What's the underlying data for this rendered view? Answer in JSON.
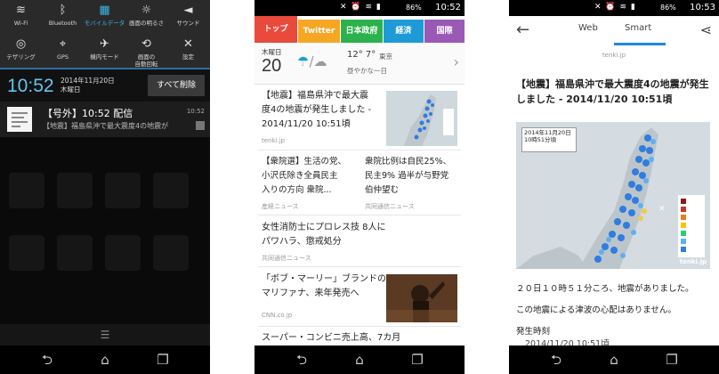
{
  "phone1": {
    "quick_settings": [
      {
        "label": "Wi-Fi",
        "icon": "wifi-icon",
        "glyph": "≋",
        "on": false
      },
      {
        "label": "Bluetooth",
        "icon": "bluetooth-icon",
        "glyph": "ᛒ",
        "on": false
      },
      {
        "label": "モバイルデータ",
        "icon": "mobile-data-icon",
        "glyph": "▦",
        "on": true
      },
      {
        "label": "画面の明るさ",
        "icon": "brightness-icon",
        "glyph": "☼",
        "on": false
      },
      {
        "label": "サウンド",
        "icon": "sound-icon",
        "glyph": "◄",
        "on": false
      },
      {
        "label": "テザリング",
        "icon": "tethering-icon",
        "glyph": "◎",
        "on": false
      },
      {
        "label": "GPS",
        "icon": "gps-icon",
        "glyph": "⌖",
        "on": false
      },
      {
        "label": "機内モード",
        "icon": "airplane-icon",
        "glyph": "✈",
        "on": false
      },
      {
        "label": "画面の\n自動回転",
        "icon": "auto-rotate-icon",
        "glyph": "⟲",
        "on": false
      },
      {
        "label": "設定",
        "icon": "settings-icon",
        "glyph": "✕",
        "on": false
      }
    ],
    "clock": "10:52",
    "date": "2014年11月20日",
    "weekday": "木曜日",
    "clear_all": "すべて削除",
    "notification": {
      "title": "【号外】10:52 配信",
      "time": "10:52",
      "text": "【地震】福島県沖で最大震度4の地震が"
    }
  },
  "phone2": {
    "status_time": "10:52",
    "battery": "86%",
    "tabs": [
      {
        "label": "トップ",
        "color": "#e84a3c"
      },
      {
        "label": "Twitter",
        "color": "#f5a623"
      },
      {
        "label": "日本政府",
        "color": "#2bb24c"
      },
      {
        "label": "経済",
        "color": "#1e9bd7"
      },
      {
        "label": "国際",
        "color": "#9b59b6"
      }
    ],
    "weather": {
      "weekday": "木曜日",
      "date": "20",
      "temp": "12° 7°",
      "city": "東京",
      "desc": "昼やかな一日"
    },
    "news": [
      {
        "title": "【地震】福島県沖で最大震\n度4の地震が発生しました -\n2014/11/20 10:51頃",
        "source": "tenki.jp"
      },
      {
        "title": "【衆院選】生活の党、\n小沢氏除き全員民主\n入りの方向 衆院...",
        "source": "産経ニュース"
      },
      {
        "title": "衆院比例は自民25%、\n民主9% 過半が与野党\n伯仲望む",
        "source": "共同通信ニュース"
      },
      {
        "title": "女性消防士にプロレス技 8人に\nパワハラ、懲戒処分",
        "source": "共同通信ニュース"
      },
      {
        "title": "「ボブ・マーリー」ブランドの\nマリファナ、来年発売へ",
        "source": "CNN.co.jp"
      },
      {
        "title": "スーパー・コンビニ売上高、7カ月",
        "source": ""
      }
    ]
  },
  "phone3": {
    "status_time": "10:53",
    "battery": "86%",
    "tab_web": "Web",
    "tab_smart": "Smart",
    "site": "tenki.jp",
    "article_title": "【地震】福島県沖で最大震度4の地震が発生しました - 2014/11/20 10:51頃",
    "map_header": "2014年11月20日\n10時51分頃",
    "map_credit": "tenki.jp",
    "body1": "２０日１０時５１分ころ、地震がありました。",
    "body2": "この地震による津波の心配はありません。",
    "body3": "発生時刻",
    "body4": "2014/11/20 10:51頃"
  },
  "nav": {
    "back": "back-icon",
    "home": "home-icon",
    "recents": "recents-icon"
  }
}
